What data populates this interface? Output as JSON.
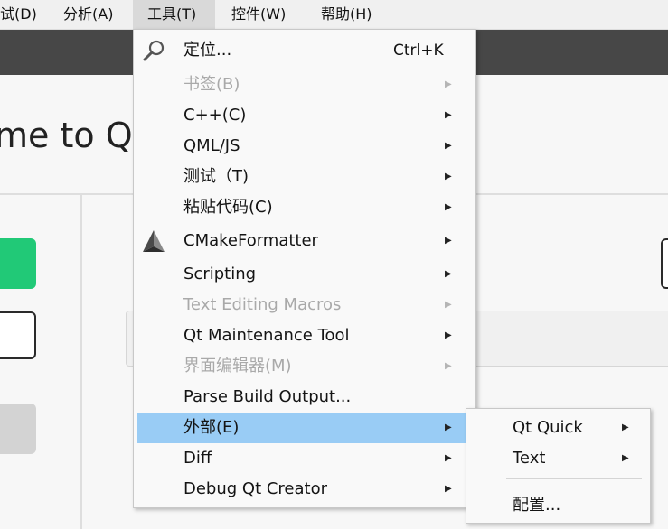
{
  "menubar": {
    "items": [
      {
        "label": "试(D)"
      },
      {
        "label": "分析(A)"
      },
      {
        "label": "工具(T)"
      },
      {
        "label": "控件(W)"
      },
      {
        "label": "帮助(H)"
      }
    ]
  },
  "welcome": {
    "title": "me to Qt"
  },
  "tools_menu": {
    "items": [
      {
        "label": "定位...",
        "shortcut": "Ctrl+K",
        "icon": "search-icon"
      },
      {
        "label": "书签(B)",
        "disabled": true
      },
      {
        "label": "C++(C)"
      },
      {
        "label": "QML/JS"
      },
      {
        "label": "测试（T)"
      },
      {
        "label": "粘贴代码(C)"
      },
      {
        "label": "CMakeFormatter",
        "icon": "cmake-icon"
      },
      {
        "label": "Scripting"
      },
      {
        "label": "Text Editing Macros",
        "disabled": true
      },
      {
        "label": "Qt Maintenance Tool"
      },
      {
        "label": "界面编辑器(M)",
        "disabled": true
      },
      {
        "label": "Parse Build Output..."
      },
      {
        "label": "外部(E)",
        "highlighted": true
      },
      {
        "label": "Diff"
      },
      {
        "label": "Debug Qt Creator"
      }
    ],
    "highlight_color": "#99ccf5"
  },
  "external_submenu": {
    "items": [
      {
        "label": "Qt Quick"
      },
      {
        "label": "Text"
      },
      {
        "label": "配置..."
      }
    ]
  },
  "colors": {
    "accent_green": "#21c977",
    "toolbar_dark": "#474747"
  }
}
